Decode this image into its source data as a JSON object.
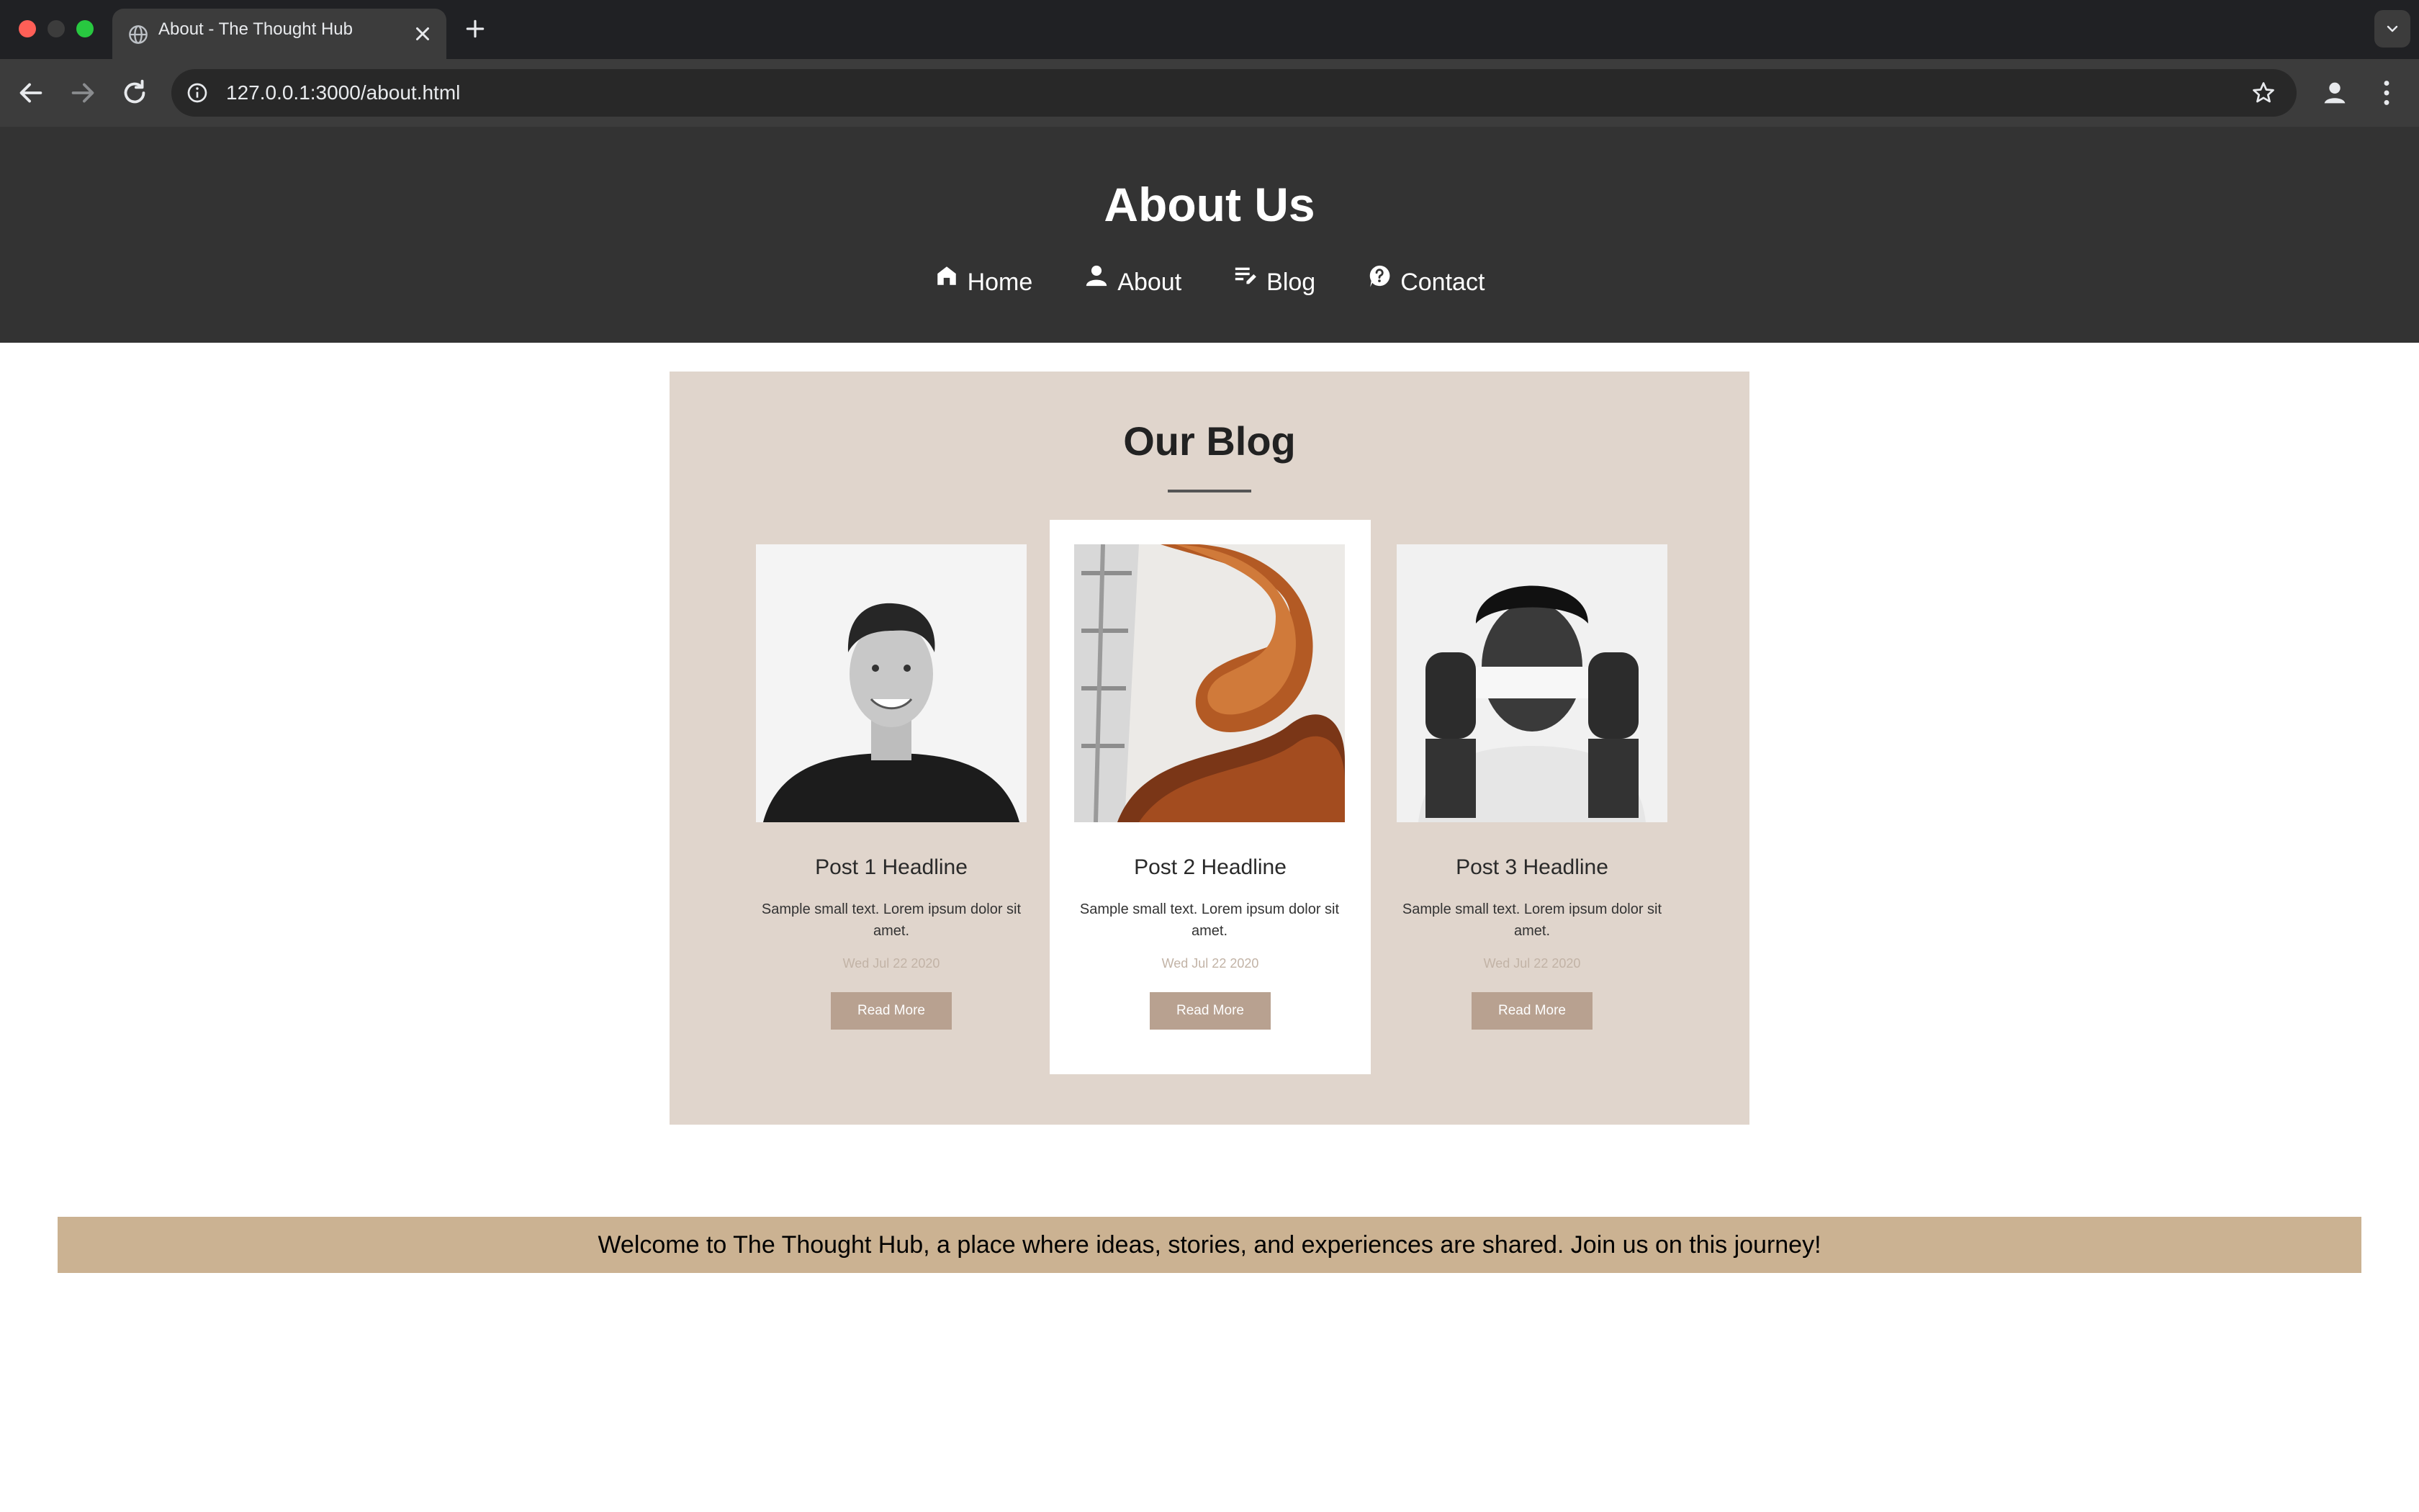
{
  "browser": {
    "tab_title": "About - The Thought Hub",
    "url": "127.0.0.1:3000/about.html"
  },
  "header": {
    "title": "About Us",
    "nav": [
      {
        "label": "Home",
        "icon": "home-icon"
      },
      {
        "label": "About",
        "icon": "person-icon"
      },
      {
        "label": "Blog",
        "icon": "edit-list-icon"
      },
      {
        "label": "Contact",
        "icon": "help-bubble-icon"
      }
    ]
  },
  "blog": {
    "heading": "Our Blog",
    "posts": [
      {
        "headline": "Post 1 Headline",
        "text": "Sample small text. Lorem ipsum dolor sit amet.",
        "date": "Wed Jul 22 2020",
        "button": "Read More",
        "image": "smiling-man-portrait"
      },
      {
        "headline": "Post 2 Headline",
        "text": "Sample small text. Lorem ipsum dolor sit amet.",
        "date": "Wed Jul 22 2020",
        "button": "Read More",
        "image": "spiral-staircase"
      },
      {
        "headline": "Post 3 Headline",
        "text": "Sample small text. Lorem ipsum dolor sit amet.",
        "date": "Wed Jul 22 2020",
        "button": "Read More",
        "image": "man-covering-eyes"
      }
    ]
  },
  "welcome": {
    "text": "Welcome to The Thought Hub, a place where ideas, stories, and experiences are shared. Join us on this journey!"
  },
  "colors": {
    "header_bg": "#333333",
    "blog_bg": "#e0d5cc",
    "button_bg": "#b8a190",
    "welcome_bg": "#cbb292"
  }
}
